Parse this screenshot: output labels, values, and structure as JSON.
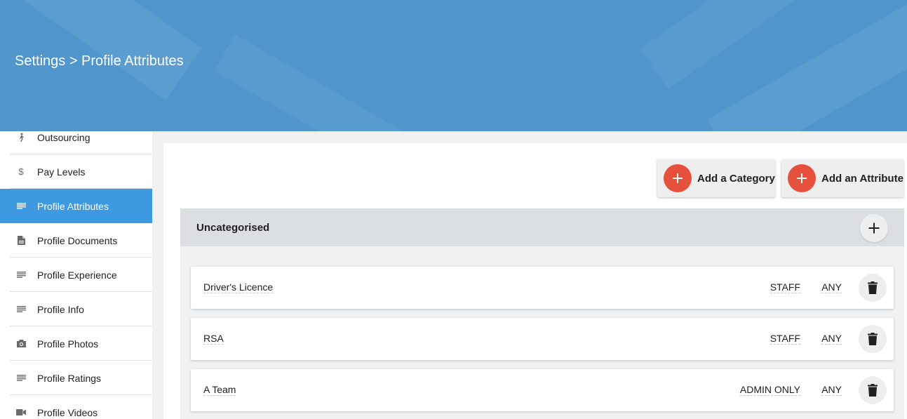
{
  "header": {
    "breadcrumb": "Settings > Profile Attributes"
  },
  "sidebar": {
    "items": [
      {
        "label": "Outsourcing",
        "icon": "walking-person-icon"
      },
      {
        "label": "Pay Levels",
        "icon": "dollar-icon"
      },
      {
        "label": "Profile Attributes",
        "icon": "list-icon",
        "active": true
      },
      {
        "label": "Profile Documents",
        "icon": "document-icon"
      },
      {
        "label": "Profile Experience",
        "icon": "list-icon"
      },
      {
        "label": "Profile Info",
        "icon": "list-icon"
      },
      {
        "label": "Profile Photos",
        "icon": "camera-icon"
      },
      {
        "label": "Profile Ratings",
        "icon": "list-icon"
      },
      {
        "label": "Profile Videos",
        "icon": "video-camera-icon"
      }
    ]
  },
  "toolbar": {
    "add_category_label": "Add a Category",
    "add_attribute_label": "Add an Attribute"
  },
  "category": {
    "title": "Uncategorised",
    "attributes": [
      {
        "name": "Driver's Licence",
        "role": "STAFF",
        "access": "ANY"
      },
      {
        "name": "RSA",
        "role": "STAFF",
        "access": "ANY"
      },
      {
        "name": "A Team",
        "role": "ADMIN ONLY",
        "access": "ANY"
      }
    ]
  },
  "colors": {
    "header_bg": "#5096cc",
    "active_item": "#3d99e0",
    "add_button": "#e5513d"
  }
}
